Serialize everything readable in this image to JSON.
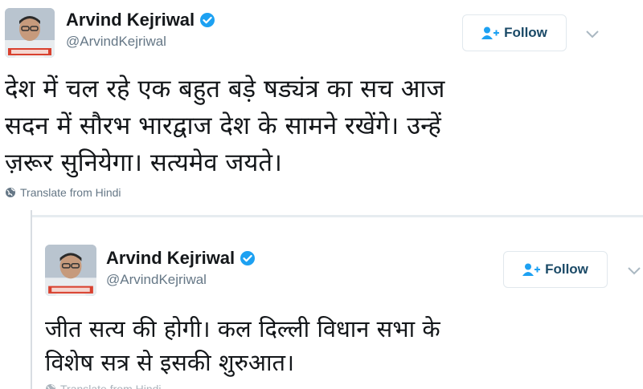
{
  "tweets": [
    {
      "author": {
        "name": "Arvind Kejriwal",
        "handle": "@ArvindKejriwal"
      },
      "follow_label": "Follow",
      "text": "देश में चल रहे एक बहुत बड़े षड्यंत्र का सच आज\nसदन में सौरभ भारद्वाज देश के सामने रखेंगे। उन्हें\nज़रूर सुनियेगा। सत्यमेव जयते।",
      "translate_label": "Translate from Hindi"
    },
    {
      "author": {
        "name": "Arvind Kejriwal",
        "handle": "@ArvindKejriwal"
      },
      "follow_label": "Follow",
      "text": "जीत सत्य की होगी। कल दिल्ली विधान सभा के\nविशेष सत्र से इसकी शुरुआत।",
      "translate_label": "Translate from Hindi"
    }
  ],
  "icons": {
    "verified": "verified-badge-icon",
    "follow": "add-user-icon",
    "menu": "chevron-down-icon",
    "translate": "globe-icon"
  },
  "colors": {
    "verified": "#1da1f2",
    "follow_text": "#1b4a67",
    "secondary_text": "#657786",
    "border": "#e1e8ed"
  }
}
